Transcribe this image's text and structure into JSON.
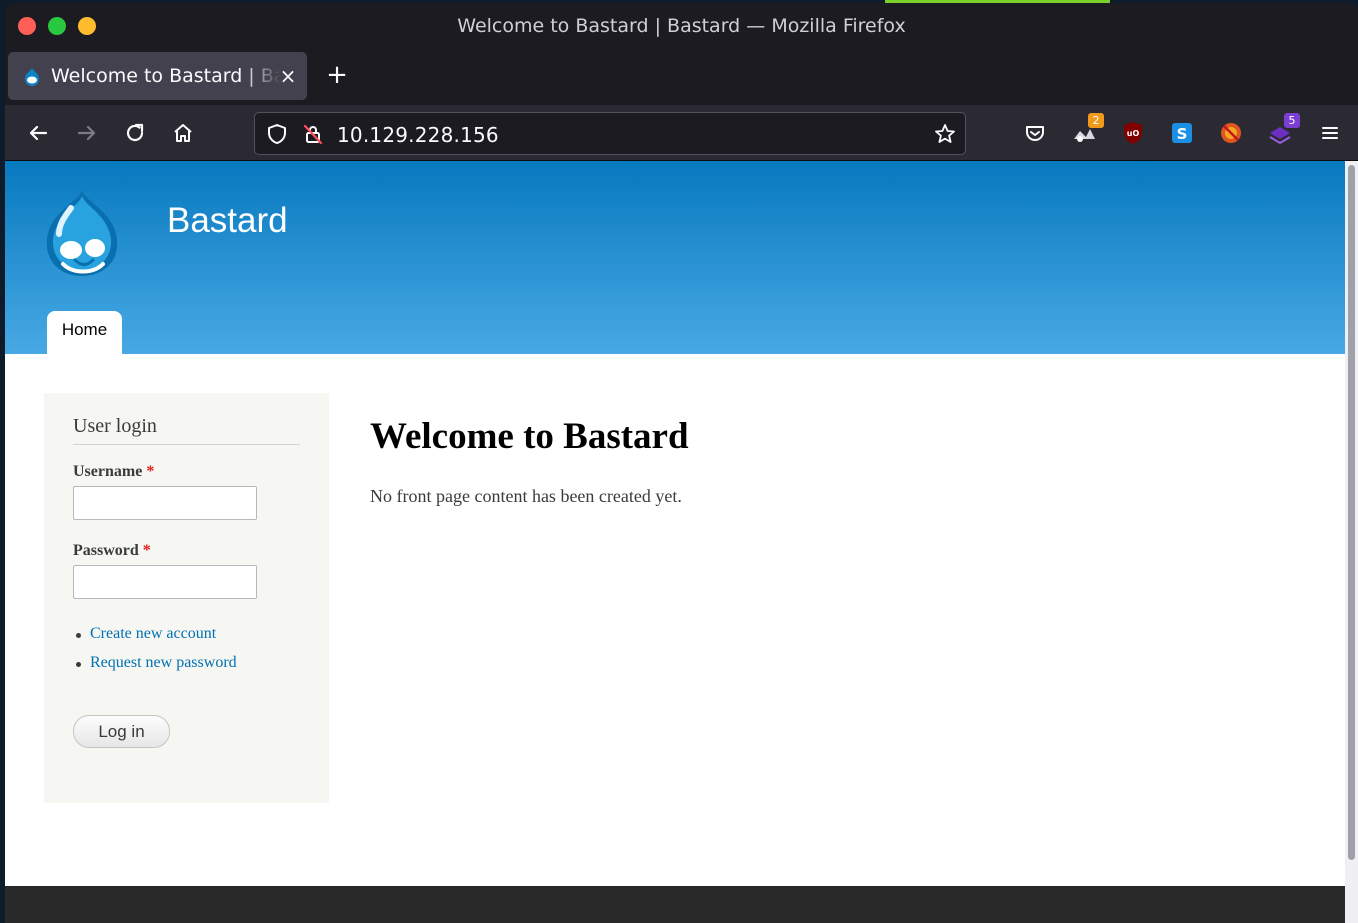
{
  "window": {
    "title": "Welcome to Bastard | Bastard — Mozilla Firefox"
  },
  "tab": {
    "title": "Welcome to Bastard | Bastard",
    "close_glyph": "×",
    "new_tab_glyph": "+"
  },
  "toolbar": {
    "url": "10.129.228.156",
    "extensions": [
      {
        "name": "extension-2",
        "badge": "2",
        "badge_color": "#f09a1b"
      },
      {
        "name": "ublock-origin",
        "badge": ""
      },
      {
        "name": "extension-s",
        "badge": ""
      },
      {
        "name": "extension-blocked",
        "badge": ""
      },
      {
        "name": "extension-5",
        "badge": "5",
        "badge_color": "#7a3fd1"
      }
    ]
  },
  "site": {
    "name": "Bastard",
    "menu": [
      "Home"
    ],
    "header_gradient": [
      "#0779bf",
      "#48a9e4"
    ]
  },
  "login_block": {
    "title": "User login",
    "username_label": "Username",
    "password_label": "Password",
    "required_mark": "*",
    "links": [
      "Create new account",
      "Request new password"
    ],
    "submit_label": "Log in"
  },
  "content": {
    "title": "Welcome to Bastard",
    "text": "No front page content has been created yet."
  },
  "colors": {
    "link": "#0071b3",
    "required": "#e01c1c",
    "footer": "#292929"
  }
}
